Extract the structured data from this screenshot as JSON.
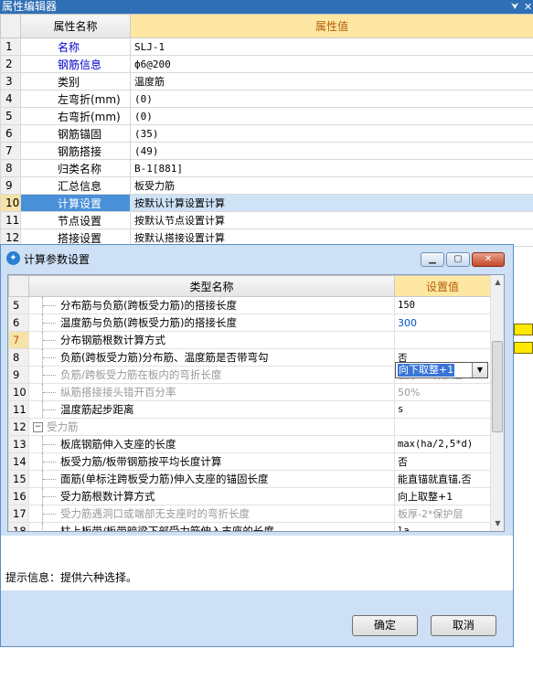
{
  "editor": {
    "title": "属性编辑器",
    "pin_icon": "pin-icon",
    "close_icon": "close-icon",
    "header_name": "属性名称",
    "header_value": "属性值",
    "rows": [
      {
        "num": "1",
        "name": "名称",
        "value": "SLJ-1",
        "blue": true
      },
      {
        "num": "2",
        "name": "钢筋信息",
        "value": "ф6@200",
        "blue": true
      },
      {
        "num": "3",
        "name": "类别",
        "value": "温度筋",
        "blue": false
      },
      {
        "num": "4",
        "name": "左弯折(mm)",
        "value": "(0)",
        "blue": false
      },
      {
        "num": "5",
        "name": "右弯折(mm)",
        "value": "(0)",
        "blue": false
      },
      {
        "num": "6",
        "name": "钢筋锚固",
        "value": "(35)",
        "blue": false
      },
      {
        "num": "7",
        "name": "钢筋搭接",
        "value": "(49)",
        "blue": false
      },
      {
        "num": "8",
        "name": "归类名称",
        "value": "B-1[881]",
        "blue": false
      },
      {
        "num": "9",
        "name": "汇总信息",
        "value": "板受力筋",
        "blue": false
      },
      {
        "num": "10",
        "name": "计算设置",
        "value": "按默认计算设置计算",
        "blue": false
      },
      {
        "num": "11",
        "name": "节点设置",
        "value": "按默认节点设置计算",
        "blue": false
      },
      {
        "num": "12",
        "name": "搭接设置",
        "value": "按默认搭接设置计算",
        "blue": false
      }
    ]
  },
  "dialog": {
    "title": "计算参数设置",
    "header_name": "类型名称",
    "header_value": "设置值",
    "rows": [
      {
        "num": "5",
        "name": "分布筋与负筋(跨板受力筋)的搭接长度",
        "value": "150"
      },
      {
        "num": "6",
        "name": "温度筋与负筋(跨板受力筋)的搭接长度",
        "value": "300"
      },
      {
        "num": "7",
        "name": "分布钢筋根数计算方式",
        "value": "向下取整+1"
      },
      {
        "num": "8",
        "name": "负筋(跨板受力筋)分布筋、温度筋是否带弯勾",
        "value": "否"
      },
      {
        "num": "9",
        "name": "负筋/跨板受力筋在板内的弯折长度",
        "value": "板厚-2*保护层"
      },
      {
        "num": "10",
        "name": "纵筋搭接接头错开百分率",
        "value": "50%"
      },
      {
        "num": "11",
        "name": "温度筋起步距离",
        "value": "s"
      },
      {
        "num": "12",
        "name": "受力筋",
        "value": ""
      },
      {
        "num": "13",
        "name": "板底钢筋伸入支座的长度",
        "value": "max(ha/2,5*d)"
      },
      {
        "num": "14",
        "name": "板受力筋/板带钢筋按平均长度计算",
        "value": "否"
      },
      {
        "num": "15",
        "name": "面筋(单标注跨板受力筋)伸入支座的锚固长度",
        "value": "能直锚就直锚,否"
      },
      {
        "num": "16",
        "name": "受力筋根数计算方式",
        "value": "向上取整+1"
      },
      {
        "num": "17",
        "name": "受力筋遇洞口或端部无支座时的弯折长度",
        "value": "板厚-2*保护层"
      },
      {
        "num": "18",
        "name": "柱上板带/板带暗梁下部受力筋伸入支座的长度",
        "value": "la"
      },
      {
        "num": "19",
        "name": "柱上板带/板带暗梁上部受力筋伸入支座的长度",
        "value": "0.6*Lab+15*d"
      }
    ],
    "combo_value": "向下取整+1",
    "hint": "提示信息：提供六种选择。",
    "ok_label": "确定",
    "cancel_label": "取消"
  }
}
